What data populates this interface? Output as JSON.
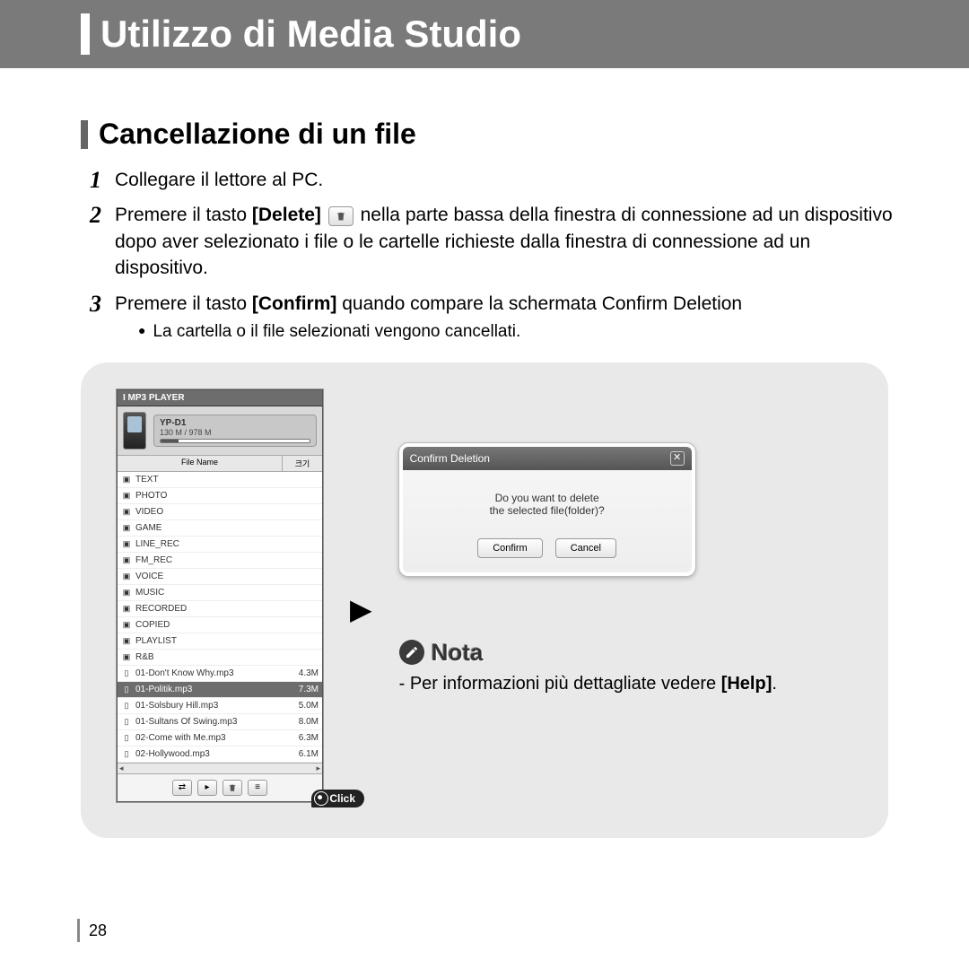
{
  "header": {
    "title": "Utilizzo di Media Studio"
  },
  "section": {
    "title": "Cancellazione di un file"
  },
  "steps": {
    "s1": "Collegare il lettore al PC.",
    "s2_a": "Premere il tasto ",
    "s2_bold1": "[Delete]",
    "s2_b": " nella parte bassa della finestra di connessione ad un dispositivo dopo aver selezionato i file o le cartelle richieste dalla finestra di connessione ad un dispositivo.",
    "s3_a": "Premere il tasto ",
    "s3_bold": "[Confirm]",
    "s3_b": " quando compare la schermata Confirm Deletion",
    "s3_bullet": "La cartella o il file selezionati vengono cancellati."
  },
  "player": {
    "title": "I MP3 PLAYER",
    "device_name": "YP-D1",
    "device_space": "130 M / 978 M",
    "col_name": "File Name",
    "col_size": "크기",
    "rows": [
      {
        "icon": "folder",
        "name": "TEXT",
        "size": ""
      },
      {
        "icon": "folder",
        "name": "PHOTO",
        "size": ""
      },
      {
        "icon": "folder",
        "name": "VIDEO",
        "size": ""
      },
      {
        "icon": "folder",
        "name": "GAME",
        "size": ""
      },
      {
        "icon": "folder",
        "name": "LINE_REC",
        "size": ""
      },
      {
        "icon": "folder",
        "name": "FM_REC",
        "size": ""
      },
      {
        "icon": "folder",
        "name": "VOICE",
        "size": ""
      },
      {
        "icon": "folder",
        "name": "MUSIC",
        "size": ""
      },
      {
        "icon": "folder",
        "name": "RECORDED",
        "size": ""
      },
      {
        "icon": "folder",
        "name": "COPIED",
        "size": ""
      },
      {
        "icon": "folder",
        "name": "PLAYLIST",
        "size": ""
      },
      {
        "icon": "folder",
        "name": "R&B",
        "size": ""
      },
      {
        "icon": "file",
        "name": "01-Don't Know Why.mp3",
        "size": "4.3M"
      },
      {
        "icon": "file",
        "name": "01-Politik.mp3",
        "size": "7.3M",
        "selected": true
      },
      {
        "icon": "file",
        "name": "01-Solsbury Hill.mp3",
        "size": "5.0M"
      },
      {
        "icon": "file",
        "name": "01-Sultans Of Swing.mp3",
        "size": "8.0M"
      },
      {
        "icon": "file",
        "name": "02-Come with Me.mp3",
        "size": "6.3M"
      },
      {
        "icon": "file",
        "name": "02-Hollywood.mp3",
        "size": "6.1M"
      }
    ],
    "click_label": "Click"
  },
  "dialog": {
    "title": "Confirm Deletion",
    "msg1": "Do you want to delete",
    "msg2": "the selected file(folder)?",
    "confirm": "Confirm",
    "cancel": "Cancel"
  },
  "note": {
    "label": "Nota",
    "body_prefix": "- Per informazioni più dettagliate vedere ",
    "body_bold": "[Help]",
    "body_suffix": "."
  },
  "page_number": "28"
}
